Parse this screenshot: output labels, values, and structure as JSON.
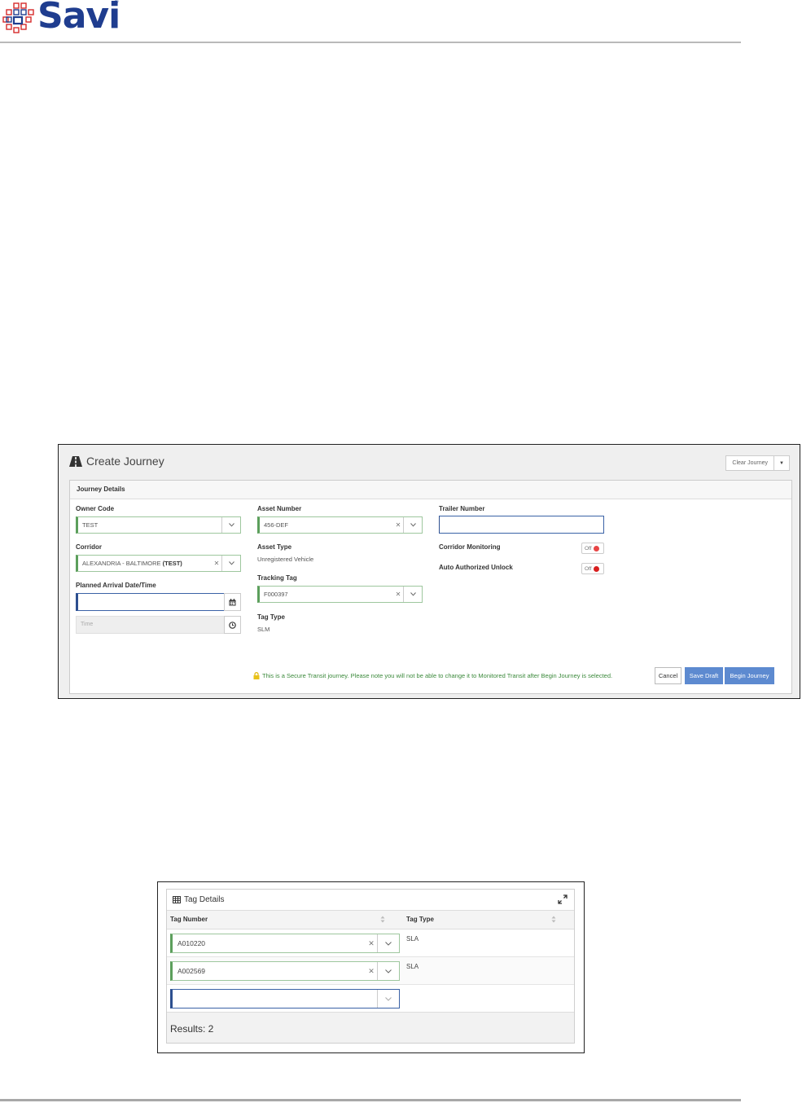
{
  "logo": {
    "text": "Savi",
    "registered": "®"
  },
  "create_journey": {
    "title": "Create Journey",
    "clear_button": "Clear Journey",
    "panel_title": "Journey Details",
    "owner_code": {
      "label": "Owner Code",
      "value": "TEST"
    },
    "corridor": {
      "label": "Corridor",
      "value_prefix": "ALEXANDRIA - BALTIMORE ",
      "value_strong": "(TEST)"
    },
    "planned_arrival": {
      "label": "Planned Arrival Date/Time",
      "time_placeholder": "Time"
    },
    "asset_number": {
      "label": "Asset Number",
      "value": "456-DEF"
    },
    "asset_type": {
      "label": "Asset Type",
      "value": "Unregistered Vehicle"
    },
    "tracking_tag": {
      "label": "Tracking Tag",
      "value": "F000397"
    },
    "tag_type": {
      "label": "Tag Type",
      "value": "SLM"
    },
    "trailer_number": {
      "label": "Trailer Number",
      "value": ""
    },
    "corridor_monitoring": {
      "label": "Corridor Monitoring",
      "state": "Off",
      "dot_color": "#e84545"
    },
    "auto_unlock": {
      "label": "Auto Authorized Unlock",
      "state": "Off",
      "dot_color": "#d81e1e"
    },
    "notice": "This is a Secure Transit journey. Please note you will not be able to change it to Monitored Transit after Begin Journey is selected.",
    "buttons": {
      "cancel": "Cancel",
      "save_draft": "Save Draft",
      "begin": "Begin Journey"
    }
  },
  "tag_details": {
    "title": "Tag Details",
    "columns": [
      "Tag Number",
      "Tag Type"
    ],
    "rows": [
      {
        "tag_number": "A010220",
        "tag_type": "SLA"
      },
      {
        "tag_number": "A002569",
        "tag_type": "SLA"
      }
    ],
    "results": "Results: 2"
  },
  "colors": {
    "brand": "#1f3d8f",
    "accent_red": "#d62b2b",
    "button_blue": "#5d8ad0",
    "valid_green": "#5c9f5c"
  }
}
